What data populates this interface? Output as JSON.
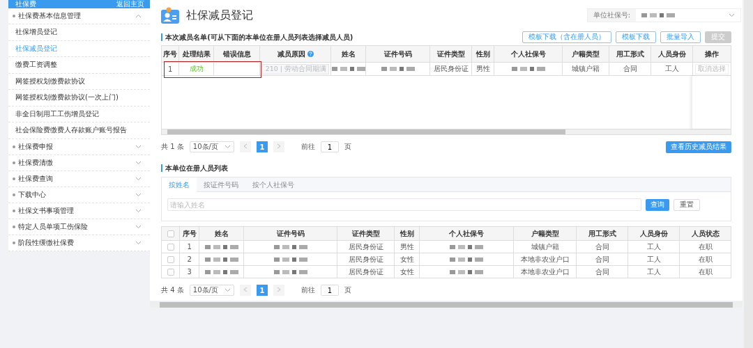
{
  "sidebar": {
    "header": {
      "title": "社保费",
      "link": "返回主页"
    },
    "groups": [
      {
        "label": "社保费基本信息管理",
        "expanded": true,
        "items": [
          {
            "label": "社保增员登记",
            "selected": false
          },
          {
            "label": "社保减员登记",
            "selected": true
          },
          {
            "label": "缴费工资调整",
            "selected": false
          },
          {
            "label": "网签授权划缴费款协议",
            "selected": false
          },
          {
            "label": "网签授权划缴费款协议(一次上门)",
            "selected": false
          },
          {
            "label": "非全日制用工工伤增员登记",
            "selected": false
          },
          {
            "label": "社会保险费缴费人存款账户账号报告",
            "selected": false
          }
        ]
      },
      {
        "label": "社保费申报",
        "expanded": false
      },
      {
        "label": "社保费清缴",
        "expanded": false
      },
      {
        "label": "社保费查询",
        "expanded": false
      },
      {
        "label": "下载中心",
        "expanded": false
      },
      {
        "label": "社保文书事项管理",
        "expanded": false
      },
      {
        "label": "特定人员单项工伤保险",
        "expanded": false
      },
      {
        "label": "阶段性缓缴社保费",
        "expanded": false
      }
    ]
  },
  "page": {
    "title": "社保减员登记",
    "unit_field": {
      "label": "单位社保号:"
    },
    "reduction": {
      "title": "本次减员名单(可从下面的本单位在册人员列表选择减员人员)",
      "buttons": [
        {
          "label": "模板下载（含在册人员）",
          "disabled": false
        },
        {
          "label": "模板下载",
          "disabled": false
        },
        {
          "label": "批量导入",
          "disabled": false
        },
        {
          "label": "提交",
          "disabled": true
        }
      ],
      "columns": [
        {
          "label": "序号"
        },
        {
          "label": "处理结果"
        },
        {
          "label": "错误信息"
        },
        {
          "label": "减员原因",
          "help": true
        },
        {
          "label": "姓名"
        },
        {
          "label": "证件号码"
        },
        {
          "label": "证件类型"
        },
        {
          "label": "性别"
        },
        {
          "label": "个人社保号"
        },
        {
          "label": "户籍类型"
        },
        {
          "label": "用工形式"
        },
        {
          "label": "人员身份"
        },
        {
          "label": "操作"
        }
      ],
      "rows": [
        {
          "highlighted": true,
          "cells": [
            {
              "kind": "text",
              "text": "1"
            },
            {
              "kind": "success",
              "text": "成功"
            },
            {
              "kind": "blank"
            },
            {
              "kind": "select",
              "text": "210 | 劳动合同期满",
              "disabled": true
            },
            {
              "kind": "redacted"
            },
            {
              "kind": "redacted"
            },
            {
              "kind": "text",
              "text": "居民身份证"
            },
            {
              "kind": "text",
              "text": "男性"
            },
            {
              "kind": "redacted"
            },
            {
              "kind": "text",
              "text": "城镇户籍"
            },
            {
              "kind": "text",
              "text": "合同"
            },
            {
              "kind": "text",
              "text": "工人"
            },
            {
              "kind": "button",
              "text": "取消选择",
              "disabled": true
            }
          ]
        }
      ],
      "pagination": {
        "total": "共 1 条",
        "page_size": "10条/页",
        "pages": [
          {
            "label": "1",
            "selected": true
          }
        ],
        "goto_label": "前往",
        "goto_value": "1",
        "page_suffix": "页"
      },
      "history_button": "查看历史减员结果"
    },
    "registered": {
      "title": "本单位在册人员列表",
      "tabs": [
        {
          "label": "按姓名",
          "selected": true
        },
        {
          "label": "按证件号码",
          "selected": false
        },
        {
          "label": "按个人社保号",
          "selected": false
        }
      ],
      "search": {
        "placeholder": "请输入姓名",
        "query_button": "查询",
        "reset_button": "重置"
      },
      "columns": [
        {
          "kind": "checkbox",
          "checked": false
        },
        {
          "label": "序号"
        },
        {
          "label": "姓名"
        },
        {
          "label": "证件号码"
        },
        {
          "label": "证件类型"
        },
        {
          "label": "性别"
        },
        {
          "label": "个人社保号"
        },
        {
          "label": "户籍类型"
        },
        {
          "label": "用工形式"
        },
        {
          "label": "人员身份"
        },
        {
          "label": "人员状态"
        }
      ],
      "rows": [
        {
          "cells": [
            {
              "kind": "checkbox",
              "checked": false
            },
            {
              "kind": "text",
              "text": "1"
            },
            {
              "kind": "redacted"
            },
            {
              "kind": "redacted"
            },
            {
              "kind": "text",
              "text": "居民身份证"
            },
            {
              "kind": "text",
              "text": "男性"
            },
            {
              "kind": "redacted"
            },
            {
              "kind": "text",
              "text": "城镇户籍"
            },
            {
              "kind": "text",
              "text": "合同"
            },
            {
              "kind": "text",
              "text": "工人"
            },
            {
              "kind": "text",
              "text": "在职"
            }
          ]
        },
        {
          "cells": [
            {
              "kind": "checkbox",
              "checked": false
            },
            {
              "kind": "text",
              "text": "2"
            },
            {
              "kind": "redacted"
            },
            {
              "kind": "redacted"
            },
            {
              "kind": "text",
              "text": "居民身份证"
            },
            {
              "kind": "text",
              "text": "女性"
            },
            {
              "kind": "redacted"
            },
            {
              "kind": "text",
              "text": "本地非农业户口"
            },
            {
              "kind": "text",
              "text": "合同"
            },
            {
              "kind": "text",
              "text": "工人"
            },
            {
              "kind": "text",
              "text": "在职"
            }
          ]
        },
        {
          "cells": [
            {
              "kind": "checkbox",
              "checked": false
            },
            {
              "kind": "text",
              "text": "3"
            },
            {
              "kind": "redacted"
            },
            {
              "kind": "redacted"
            },
            {
              "kind": "text",
              "text": "居民身份证"
            },
            {
              "kind": "text",
              "text": "女性"
            },
            {
              "kind": "redacted"
            },
            {
              "kind": "text",
              "text": "本地非农业户口"
            },
            {
              "kind": "text",
              "text": "合同"
            },
            {
              "kind": "text",
              "text": "工人"
            },
            {
              "kind": "text",
              "text": "在职"
            }
          ]
        }
      ],
      "pagination": {
        "total": "共 4 条",
        "page_size": "10条/页",
        "pages": [
          {
            "label": "1",
            "selected": true
          }
        ],
        "goto_label": "前往",
        "goto_value": "1",
        "page_suffix": "页"
      }
    }
  }
}
